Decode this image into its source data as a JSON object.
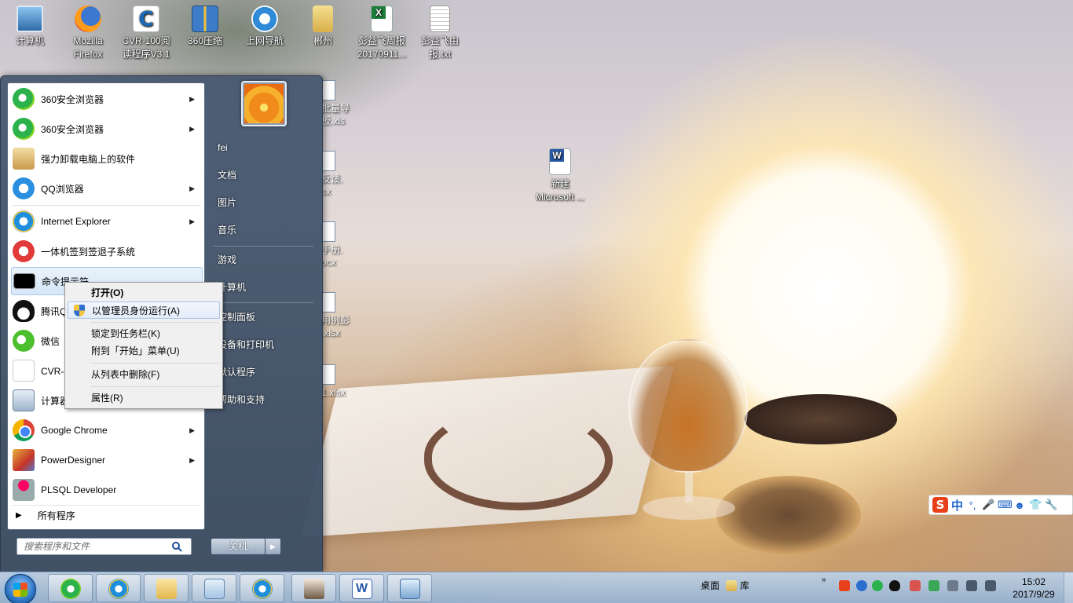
{
  "desktop": {
    "icons": [
      {
        "label": "计算机"
      },
      {
        "label": "Mozilla Firefox"
      },
      {
        "label": "CVR-100阅读程序V3.1"
      },
      {
        "label": "360压缩"
      },
      {
        "label": "上网导航"
      },
      {
        "label": "郴州"
      },
      {
        "label": "彭益飞周报20170911..."
      },
      {
        "label": "彭益飞由报.txt"
      },
      {
        "label": "新建 Microsoft ..."
      }
    ],
    "partial_files": [
      {
        "line1": "批量导",
        "line2": "板.xls"
      },
      {
        "line1": "反馈.",
        "line2": "sx"
      },
      {
        "line1": "手册.",
        "line2": "ocx"
      },
      {
        "line1": "用例彭",
        "line2": ".xlsx"
      },
      {
        "line1": "1.xlsx",
        "line2": ""
      }
    ]
  },
  "start_menu": {
    "programs": [
      {
        "label": "360安全浏览器",
        "icon": "360-browser-icon",
        "has_arrow": true
      },
      {
        "label": "360安全浏览器",
        "icon": "360-browser-icon",
        "has_arrow": true
      },
      {
        "label": "强力卸载电脑上的软件",
        "icon": "uninstall-icon",
        "has_arrow": false
      },
      {
        "label": "QQ浏览器",
        "icon": "qq-browser-icon",
        "has_arrow": true
      },
      {
        "label": "Internet Explorer",
        "icon": "ie-icon",
        "has_arrow": true
      },
      {
        "label": "一体机签到签退子系统",
        "icon": "sign-system-icon",
        "has_arrow": false
      },
      {
        "label": "命令提示符",
        "icon": "cmd-icon",
        "has_arrow": false
      },
      {
        "label": "腾讯QQ",
        "icon": "qq-penguin-icon",
        "has_arrow": false
      },
      {
        "label": "微信",
        "icon": "wechat-icon",
        "has_arrow": false
      },
      {
        "label": "CVR-100阅读程序V3.1",
        "icon": "cvr-icon",
        "has_arrow": false
      },
      {
        "label": "计算器",
        "icon": "calculator-icon",
        "has_arrow": false
      },
      {
        "label": "Google Chrome",
        "icon": "chrome-icon",
        "has_arrow": true
      },
      {
        "label": "PowerDesigner",
        "icon": "powerdesigner-icon",
        "has_arrow": true
      },
      {
        "label": "PLSQL Developer",
        "icon": "plsql-icon",
        "has_arrow": false
      }
    ],
    "all_programs": "所有程序",
    "search_placeholder": "搜索程序和文件",
    "right_items": [
      "fei",
      "文档",
      "图片",
      "音乐",
      "游戏",
      "计算机",
      "控制面板",
      "设备和打印机",
      "默认程序",
      "帮助和支持"
    ],
    "shutdown_label": "关机",
    "shutdown_arrow": "▶"
  },
  "context_menu": {
    "items": [
      {
        "label": "打开(O)"
      },
      {
        "label": "以管理员身份运行(A)"
      },
      {
        "label": "锁定到任务栏(K)"
      },
      {
        "label": "附到「开始」菜单(U)"
      },
      {
        "label": "从列表中删除(F)"
      },
      {
        "label": "属性(R)"
      }
    ]
  },
  "ime_bar": {
    "logo": "S",
    "mode": "中",
    "punct": "°,",
    "icons": [
      "microphone-icon",
      "keyboard-icon",
      "people-icon",
      "shirt-icon",
      "wrench-icon"
    ]
  },
  "taskbar": {
    "buttons": [
      "360-browser-icon",
      "ie-icon",
      "explorer-icon",
      "notepad-icon",
      "ie-icon",
      "user-photo-icon",
      "word-icon",
      "network-icon"
    ],
    "desktop_label": "桌面",
    "library_label": "库",
    "clock_time": "15:02",
    "clock_date": "2017/9/29"
  },
  "colors": {
    "start_menu_bg": "#465870",
    "highlight": "#d5e6f8",
    "taskbar": "#a9c0da"
  }
}
